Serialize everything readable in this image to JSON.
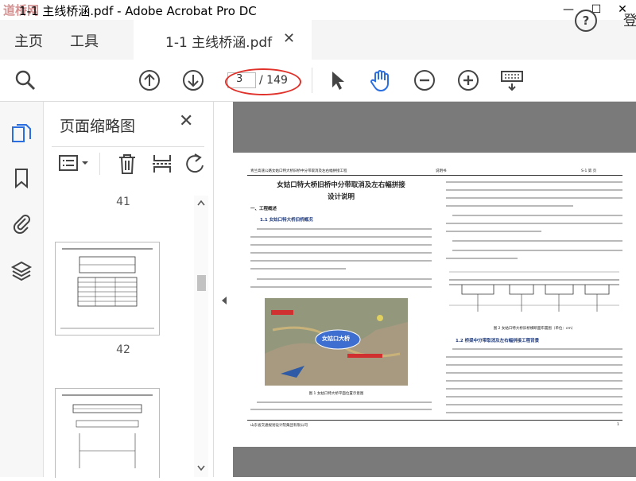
{
  "window": {
    "title": "1-1 主线桥涵.pdf - Adobe Acrobat Pro DC",
    "watermark": "道桥网",
    "minimize": "—",
    "maximize": "☐",
    "close": "✕"
  },
  "tabs": {
    "home": "主页",
    "tools": "工具",
    "document": "1-1 主线桥涵.pdf",
    "help": "?",
    "signin": "登"
  },
  "toolbar": {
    "current_page": "3",
    "total_pages": "/ 149",
    "icons": [
      "search-icon",
      "page-up-icon",
      "page-down-icon",
      "select-cursor-icon",
      "hand-tool-icon",
      "zoom-out-icon",
      "zoom-in-icon",
      "keyboard-icon"
    ]
  },
  "accent_color": "#2a6ee0",
  "annotation_color": "#e0322b",
  "thumbnails_panel": {
    "title": "页面缩略图",
    "close": "✕",
    "page_labels": [
      "41",
      "42"
    ]
  },
  "document_page": {
    "header_left": "青兰高速公路女姑口特大桥旧桥中分带取消及左右幅拼接工程",
    "header_mid": "说明书",
    "header_right": "S-1 第  页",
    "title_line1": "女姑口特大桥旧桥中分带取消及左右幅拼接",
    "title_line2": "设计说明",
    "section1": "一、工程概述",
    "section1_1": "1.1 女姑口特大桥旧桥概况",
    "map_label": "女姑口大桥",
    "fig1_caption": "图 1 女姑口特大桥平面位置示意图",
    "fig2_caption": "图 2 女姑口特大桥旧桥横断面布置图（单位：cm）",
    "section1_2": "1.2 桥梁中分带取消及左右幅拼接工程背景",
    "footer_left": "山东省交通规划设计院集团有限公司",
    "footer_right": "1"
  }
}
